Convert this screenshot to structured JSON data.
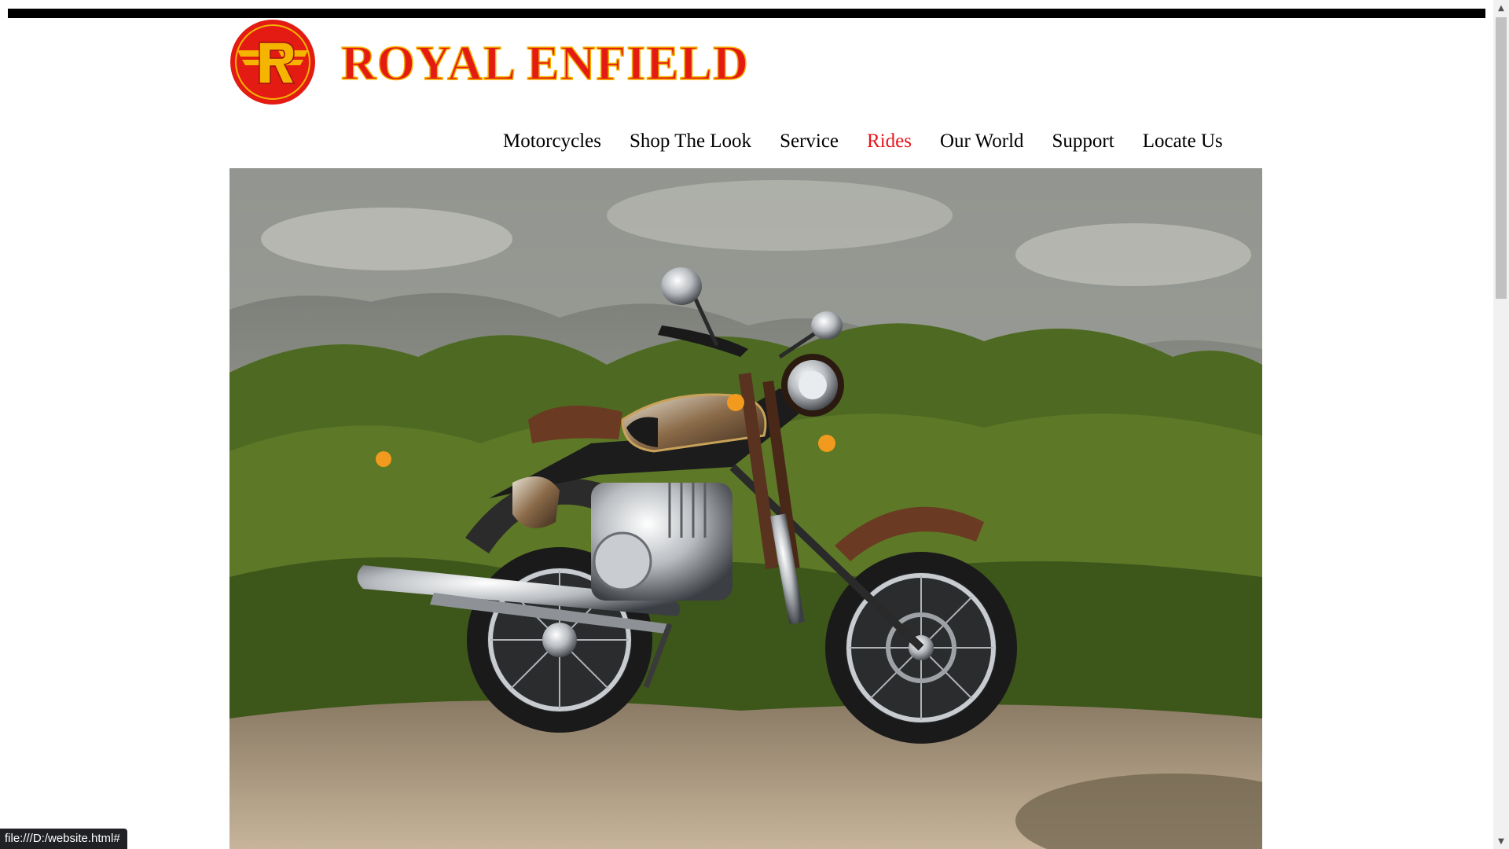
{
  "brand": {
    "name": "Royal Enfield",
    "emblem_letter": "R",
    "colors": {
      "red": "#e41b13",
      "gold": "#f4b400",
      "nav_active": "#e8141b",
      "top_bar": "#000000"
    }
  },
  "nav": {
    "items": [
      {
        "label": "Motorcycles",
        "active": false
      },
      {
        "label": "Shop The Look",
        "active": false
      },
      {
        "label": "Service",
        "active": false
      },
      {
        "label": "Rides",
        "active": true
      },
      {
        "label": "Our World",
        "active": false
      },
      {
        "label": "Support",
        "active": false
      },
      {
        "label": "Locate Us",
        "active": false
      }
    ]
  },
  "hero": {
    "image_subject": "motorcycle-photo"
  },
  "status_bar": {
    "url": "file:///D:/website.html#"
  },
  "scrollbar": {
    "up_icon": "▲",
    "down_icon": "▼"
  }
}
